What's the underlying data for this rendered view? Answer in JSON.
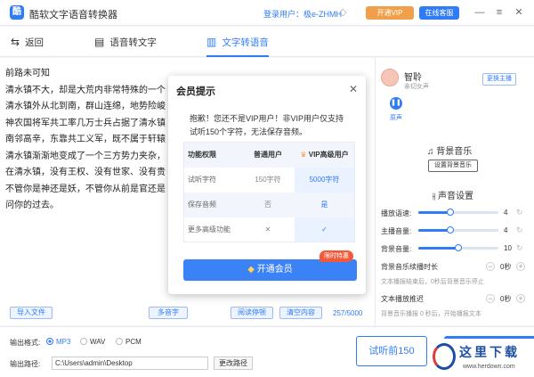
{
  "app": {
    "title": "酷软文字语音转换器",
    "logo_glyph": "酷"
  },
  "header": {
    "user": "登录用户：极e-ZHMH",
    "vip_label": "开通VIP",
    "service_label": "在线客服",
    "minimize": "—",
    "menu": "≡",
    "close": "✕"
  },
  "nav": {
    "back": "返回",
    "stt": "语音转文字",
    "tts": "文字转语音"
  },
  "editor": {
    "lines": [
      "前路未可知",
      "清水镇不大，却是大荒内非常特殊的一个",
      "清水镇外从北到南，群山连绵，地势险峻",
      "神农国将军共工率几万士兵占据了清水镇",
      "南邻高辛，东靠共工义军，既不属于轩辕",
      "清水镇渐渐地变成了一个三方势力夹杂，",
      "在清水镇，没有王权、没有世家、没有贵",
      "不管你是神还是妖，不管你从前是官还是",
      "问你的过去。"
    ],
    "import_label": "导入文件",
    "multitone_label": "多音字",
    "pause_label": "阅读停顿",
    "clear_label": "清空内容",
    "count": "257/5000"
  },
  "voice": {
    "name": "智聆",
    "desc": "亲切女声",
    "change_label": "更换主播",
    "play_label": "原声"
  },
  "bgm": {
    "title": "背景音乐",
    "set_label": "设置背景音乐"
  },
  "settings": {
    "title": "声音设置",
    "speed": {
      "label": "播放语速:",
      "value": "4",
      "fraction": 0.4
    },
    "volume": {
      "label": "主播音量:",
      "value": "4",
      "fraction": 0.4
    },
    "bg_volume": {
      "label": "背景音量:",
      "value": "10",
      "fraction": 0.5
    },
    "bg_delay": {
      "label": "背景音乐续播时长",
      "value": "0秒",
      "hint": "文本播报结束后，0秒后背景音乐停止"
    },
    "text_delay": {
      "label": "文本播放推迟",
      "value": "0秒",
      "hint": "背景音乐播报 0 秒后，开始播报文本"
    }
  },
  "bottom": {
    "format_label": "输出格式:",
    "formats": [
      "MP3",
      "WAV",
      "PCM"
    ],
    "selected_format": "MP3",
    "path_label": "输出路径:",
    "path": "C:\\Users\\admin\\Desktop",
    "change_path": "更改路径",
    "try_label": "试听前150"
  },
  "watermark": {
    "text": "这里下载",
    "url": "www.herdown.com"
  },
  "modal": {
    "title": "会员提示",
    "message_line1": "抱歉！您还不是VIP用户！非VIP用户仅支持",
    "message_line2": "试听150个字符，无法保存音频。",
    "table": {
      "headers": [
        "功能权限",
        "普通用户",
        "VIP高级用户"
      ],
      "rows": [
        [
          "试听字符",
          "150字符",
          "5000字符"
        ],
        [
          "保存音频",
          "否",
          "是"
        ],
        [
          "更多高级功能",
          "✕",
          "✓"
        ]
      ]
    },
    "badge": "限时特惠",
    "open_label": "开通会员",
    "close": "✕"
  },
  "colors": {
    "accent": "#2f7cf6",
    "vip": "#f0a04a",
    "badge": "#f05a3a"
  }
}
